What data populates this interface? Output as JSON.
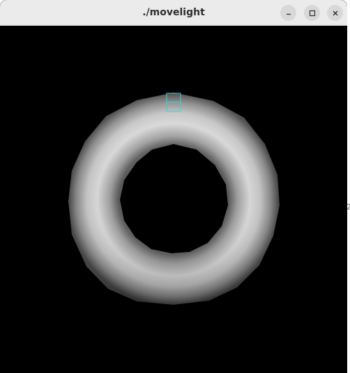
{
  "window": {
    "title": "./movelight",
    "buttons": {
      "minimize_icon": "minimize-icon",
      "maximize_icon": "maximize-icon",
      "close_icon": "close-icon"
    }
  },
  "scene": {
    "background": "#000000",
    "torus_color": "#d9d9d9",
    "light_marker_color": "#3ad4d4"
  },
  "edge_glyph": "2"
}
